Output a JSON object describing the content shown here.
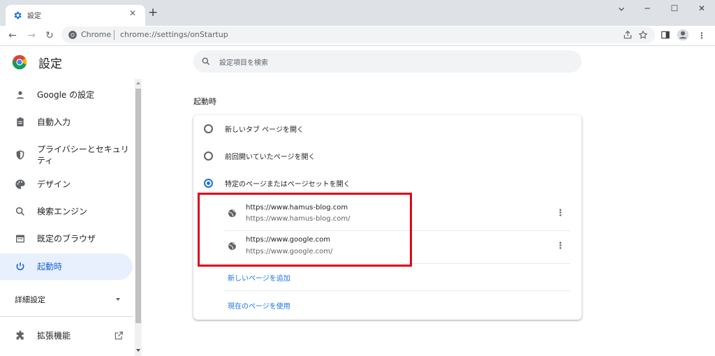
{
  "window": {
    "tab_title": "設定",
    "new_tab": "+",
    "close_tab": "✕",
    "minimize": "─",
    "maximize": "☐",
    "close": "✕"
  },
  "toolbar": {
    "back": "←",
    "forward": "→",
    "reload": "↻",
    "chip": "Chrome",
    "url": "chrome://settings/onStartup"
  },
  "sidebar": {
    "title": "設定",
    "items": [
      {
        "label": "Google の設定",
        "icon": "person-icon"
      },
      {
        "label": "自動入力",
        "icon": "clipboard-icon"
      },
      {
        "label": "プライバシーとセキュリティ",
        "icon": "shield-icon"
      },
      {
        "label": "デザイン",
        "icon": "palette-icon"
      },
      {
        "label": "検索エンジン",
        "icon": "search-icon"
      },
      {
        "label": "既定のブラウザ",
        "icon": "browser-icon"
      },
      {
        "label": "起動時",
        "icon": "power-icon"
      }
    ],
    "advanced": "詳細設定",
    "extensions": "拡張機能"
  },
  "search": {
    "placeholder": "設定項目を検索"
  },
  "main": {
    "section_title": "起動時",
    "options": [
      {
        "label": "新しいタブ ページを開く",
        "selected": false
      },
      {
        "label": "前回開いていたページを開く",
        "selected": false
      },
      {
        "label": "特定のページまたはページセットを開く",
        "selected": true
      }
    ],
    "pages": [
      {
        "title": "https://www.hamus-blog.com",
        "url": "https://www.hamus-blog.com/"
      },
      {
        "title": "https://www.google.com",
        "url": "https://www.google.com/"
      }
    ],
    "add_page": "新しいページを追加",
    "use_current": "現在のページを使用"
  },
  "colors": {
    "accent": "#1a73e8",
    "highlight_box": "#e0001b",
    "active_bg": "#e8f0fe"
  }
}
